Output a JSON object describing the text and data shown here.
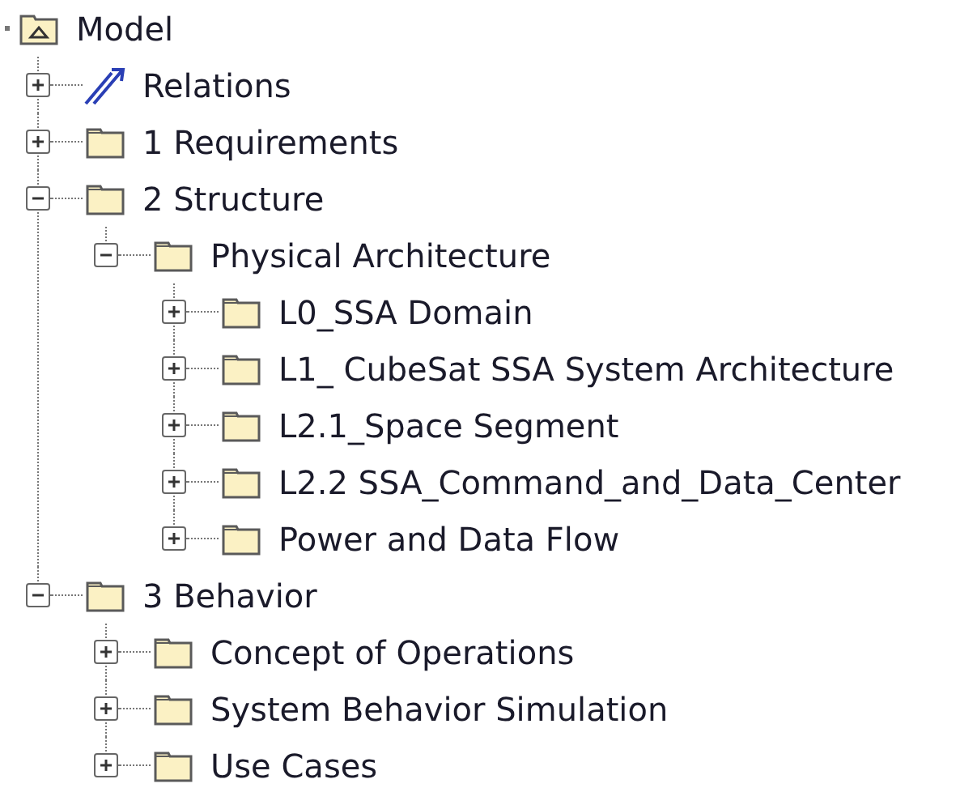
{
  "tree": {
    "label": "Model",
    "kind": "model",
    "children": [
      {
        "label": "Relations",
        "kind": "relations",
        "expanded": false
      },
      {
        "label": "1 Requirements",
        "kind": "folder",
        "expanded": false
      },
      {
        "label": "2 Structure",
        "kind": "folder",
        "expanded": true,
        "children": [
          {
            "label": "Physical Architecture",
            "kind": "folder",
            "expanded": true,
            "children": [
              {
                "label": "L0_SSA Domain",
                "kind": "folder",
                "expanded": false
              },
              {
                "label": "L1_ CubeSat SSA System Architecture",
                "kind": "folder",
                "expanded": false
              },
              {
                "label": "L2.1_Space Segment",
                "kind": "folder",
                "expanded": false
              },
              {
                "label": "L2.2 SSA_Command_and_Data_Center",
                "kind": "folder",
                "expanded": false
              },
              {
                "label": "Power and Data Flow",
                "kind": "folder",
                "expanded": false
              }
            ]
          }
        ]
      },
      {
        "label": "3 Behavior",
        "kind": "folder",
        "expanded": true,
        "children": [
          {
            "label": "Concept of Operations",
            "kind": "folder",
            "expanded": false
          },
          {
            "label": "System Behavior Simulation",
            "kind": "folder",
            "expanded": false
          },
          {
            "label": "Use Cases",
            "kind": "folder",
            "expanded": false
          }
        ]
      }
    ]
  }
}
